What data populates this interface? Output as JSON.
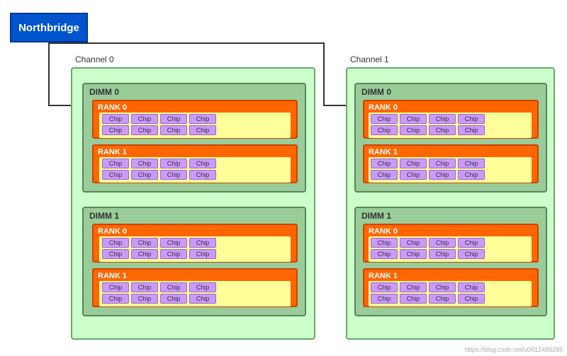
{
  "northbridge": {
    "label": "Northbridge"
  },
  "channels": [
    {
      "label": "Channel 0",
      "dimms": [
        {
          "label": "DIMM 0",
          "ranks": [
            {
              "label": "RANK 0"
            },
            {
              "label": "RANK 1"
            }
          ]
        },
        {
          "label": "DIMM 1",
          "ranks": [
            {
              "label": "RANK 0"
            },
            {
              "label": "RANK 1"
            }
          ]
        }
      ]
    },
    {
      "label": "Channel 1",
      "dimms": [
        {
          "label": "DIMM 0",
          "ranks": [
            {
              "label": "RANK 0"
            },
            {
              "label": "RANK 1"
            }
          ]
        },
        {
          "label": "DIMM 1",
          "ranks": [
            {
              "label": "RANK 0"
            },
            {
              "label": "RANK 1"
            }
          ]
        }
      ]
    }
  ],
  "chip_label": "Chip",
  "url": "https://blog.csdn.net/u0012489285"
}
